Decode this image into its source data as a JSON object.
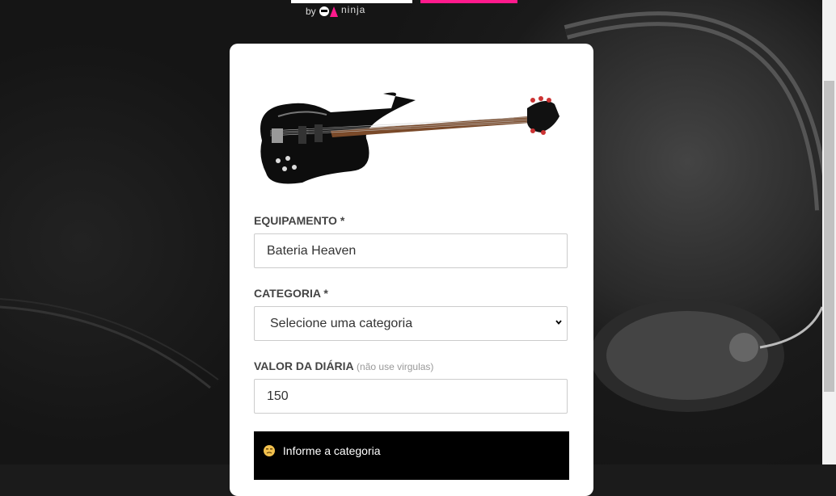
{
  "header": {
    "by_text": "by",
    "brand_text": "ninja"
  },
  "form": {
    "equipment_label": "EQUIPAMENTO *",
    "equipment_value": "Bateria Heaven",
    "category_label": "CATEGORIA *",
    "category_selected": "Selecione uma categoria",
    "daily_label": "VALOR DA DIÁRIA",
    "daily_hint": "(não use virgulas)",
    "daily_value": "150"
  },
  "toast": {
    "message": "Informe a categoria"
  },
  "colors": {
    "brand_pink": "#ff1a8c",
    "toast_bg": "#000000"
  },
  "icons": [
    "guitar-image",
    "qa-ninja-logo",
    "chevron-down-icon",
    "emoji-icon"
  ]
}
